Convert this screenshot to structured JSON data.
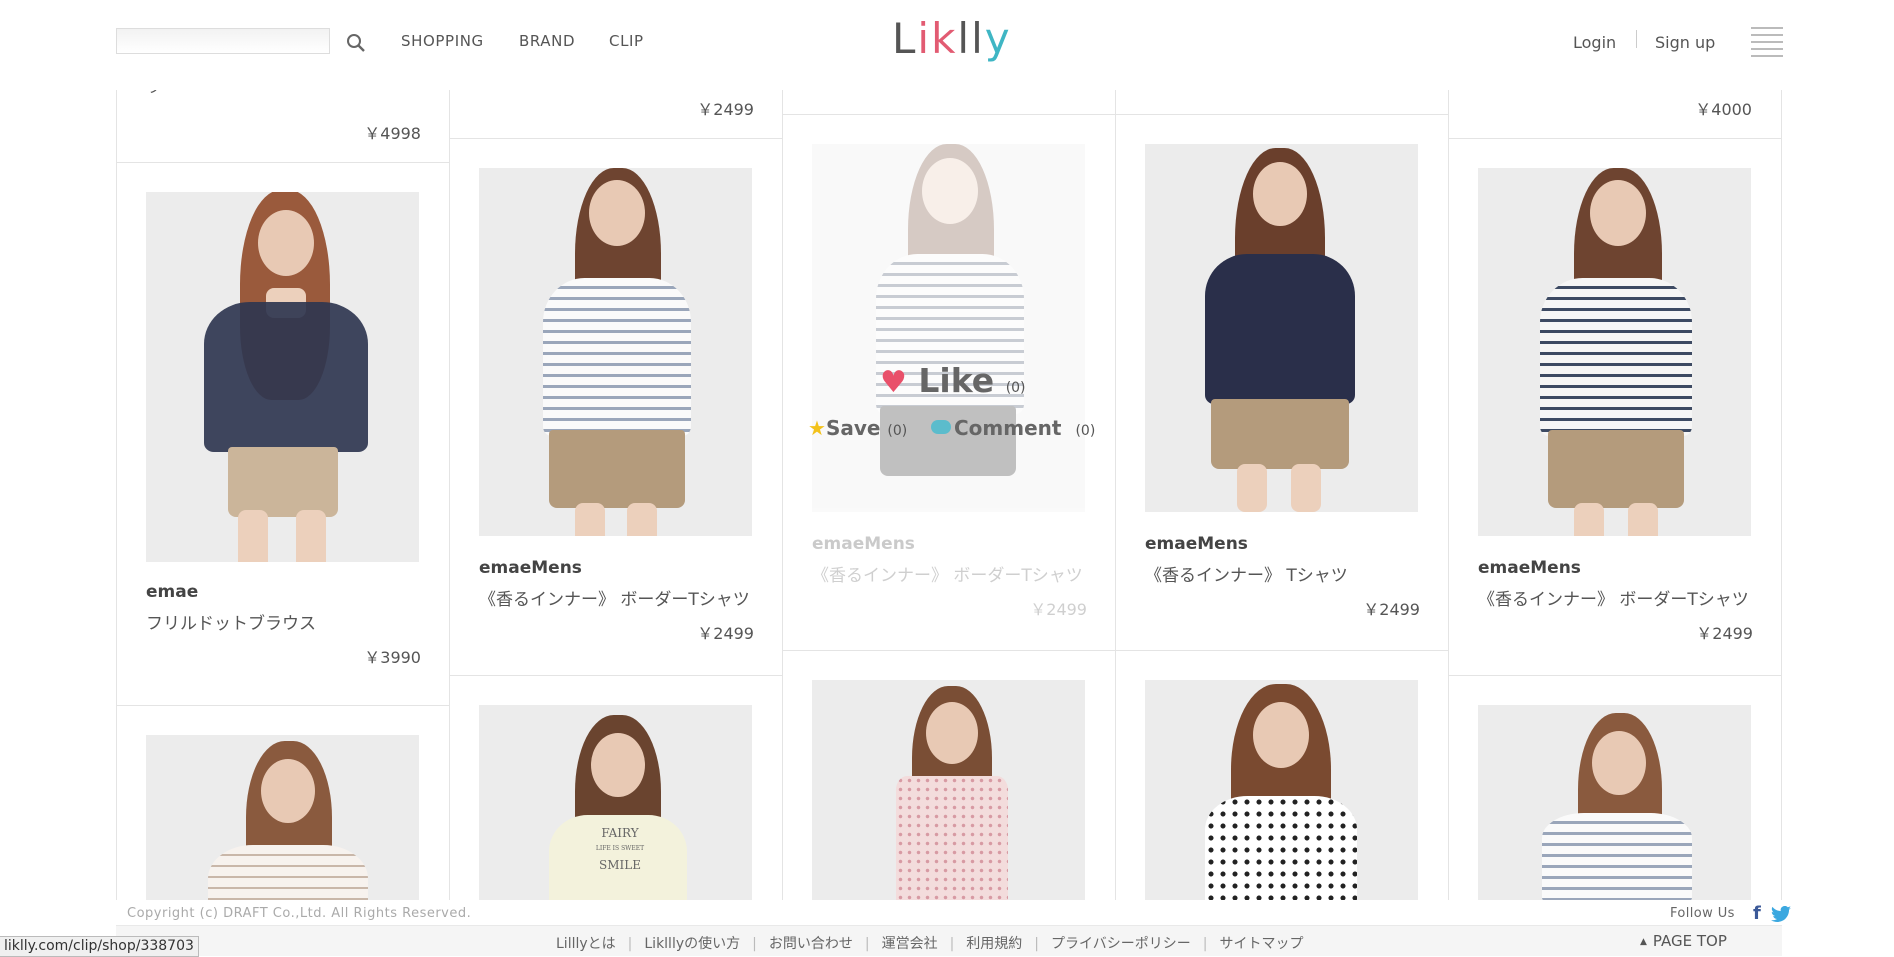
{
  "header": {
    "search": {
      "placeholder": "",
      "value": ""
    },
    "nav": [
      "SHOPPING",
      "BRAND",
      "CLIP"
    ],
    "logo": {
      "part1": "L",
      "part2": "ik",
      "part3": "ll",
      "part4": "y",
      "full": "Liklly"
    },
    "login": "Login",
    "signup": "Sign up"
  },
  "top_prices": [
    "￥4998",
    "￥2499",
    "￥4000"
  ],
  "top_partial_text": "ラー",
  "cards": [
    {
      "brand": "emae",
      "title": "フリルドットブラウス",
      "price": "￥3990"
    },
    {
      "brand": "emaeMens",
      "title": "《香るインナー》 ボーダーTシャツ",
      "price": "￥2499"
    },
    {
      "brand": "emaeMens",
      "title": "《香るインナー》 ボーダーTシャツ",
      "price": "￥2499"
    },
    {
      "brand": "emaeMens",
      "title": "《香るインナー》 Tシャツ",
      "price": "￥2499"
    },
    {
      "brand": "emaeMens",
      "title": "《香るインナー》 ボーダーTシャツ",
      "price": "￥2499"
    }
  ],
  "hover_overlay": {
    "like_label": "Like",
    "like_count": "(0)",
    "save_label": "Save",
    "save_count": "(0)",
    "comment_label": "Comment",
    "comment_count": "(0)"
  },
  "tshirt_print": {
    "line1": "FAIRY",
    "line2": "LIFE IS SWEET",
    "line3": "SMILE"
  },
  "footer": {
    "copyright": "Copyright (c) DRAFT Co.,Ltd. All Rights Reserved.",
    "follow_us": "Follow Us",
    "links": [
      "Lilllyとは",
      "Liklllyの使い方",
      "お問い合わせ",
      "運営会社",
      "利用規約",
      "プライバシーポリシー",
      "サイトマップ"
    ],
    "page_top": "PAGE TOP"
  },
  "status_bar_url": "liklly.com/clip/shop/338703",
  "colors": {
    "heart": "#e9506a",
    "star": "#f3c21b",
    "comment": "#5bbccc",
    "logo_accent1": "#e25b72",
    "logo_accent2": "#3fb6c4"
  }
}
